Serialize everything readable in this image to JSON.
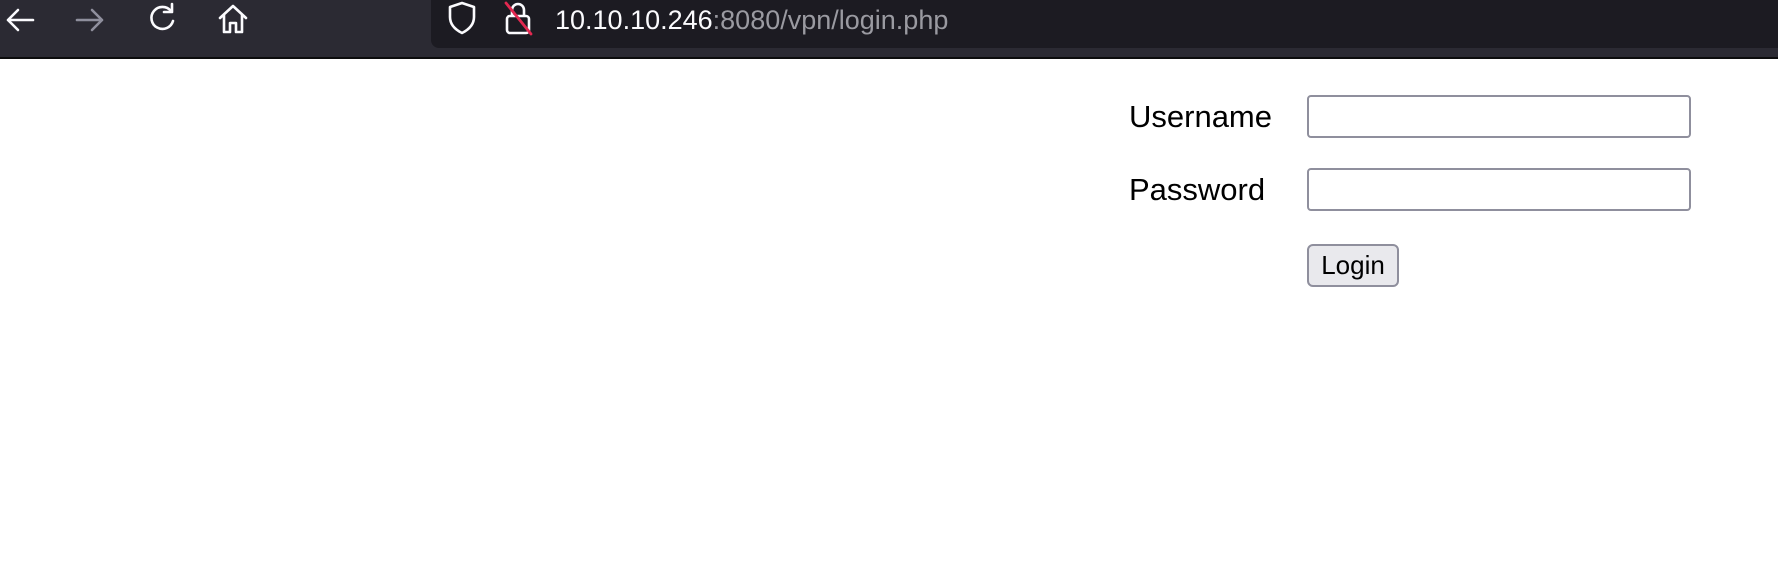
{
  "browser": {
    "url_host": "10.10.10.246",
    "url_rest": ":8080/vpn/login.php",
    "icons": [
      "back-arrow-icon",
      "forward-arrow-icon",
      "reload-icon",
      "home-icon",
      "shield-icon",
      "insecure-lock-icon"
    ]
  },
  "form": {
    "username_label": "Username",
    "username_value": "",
    "password_label": "Password",
    "password_value": "",
    "login_label": "Login"
  },
  "colors": {
    "toolbar": "#2b2a33",
    "urlbar": "#1c1b22",
    "url_host": "#fbfbfe",
    "url_rest": "#9a9aa1",
    "insecure_strike": "#e22850"
  }
}
